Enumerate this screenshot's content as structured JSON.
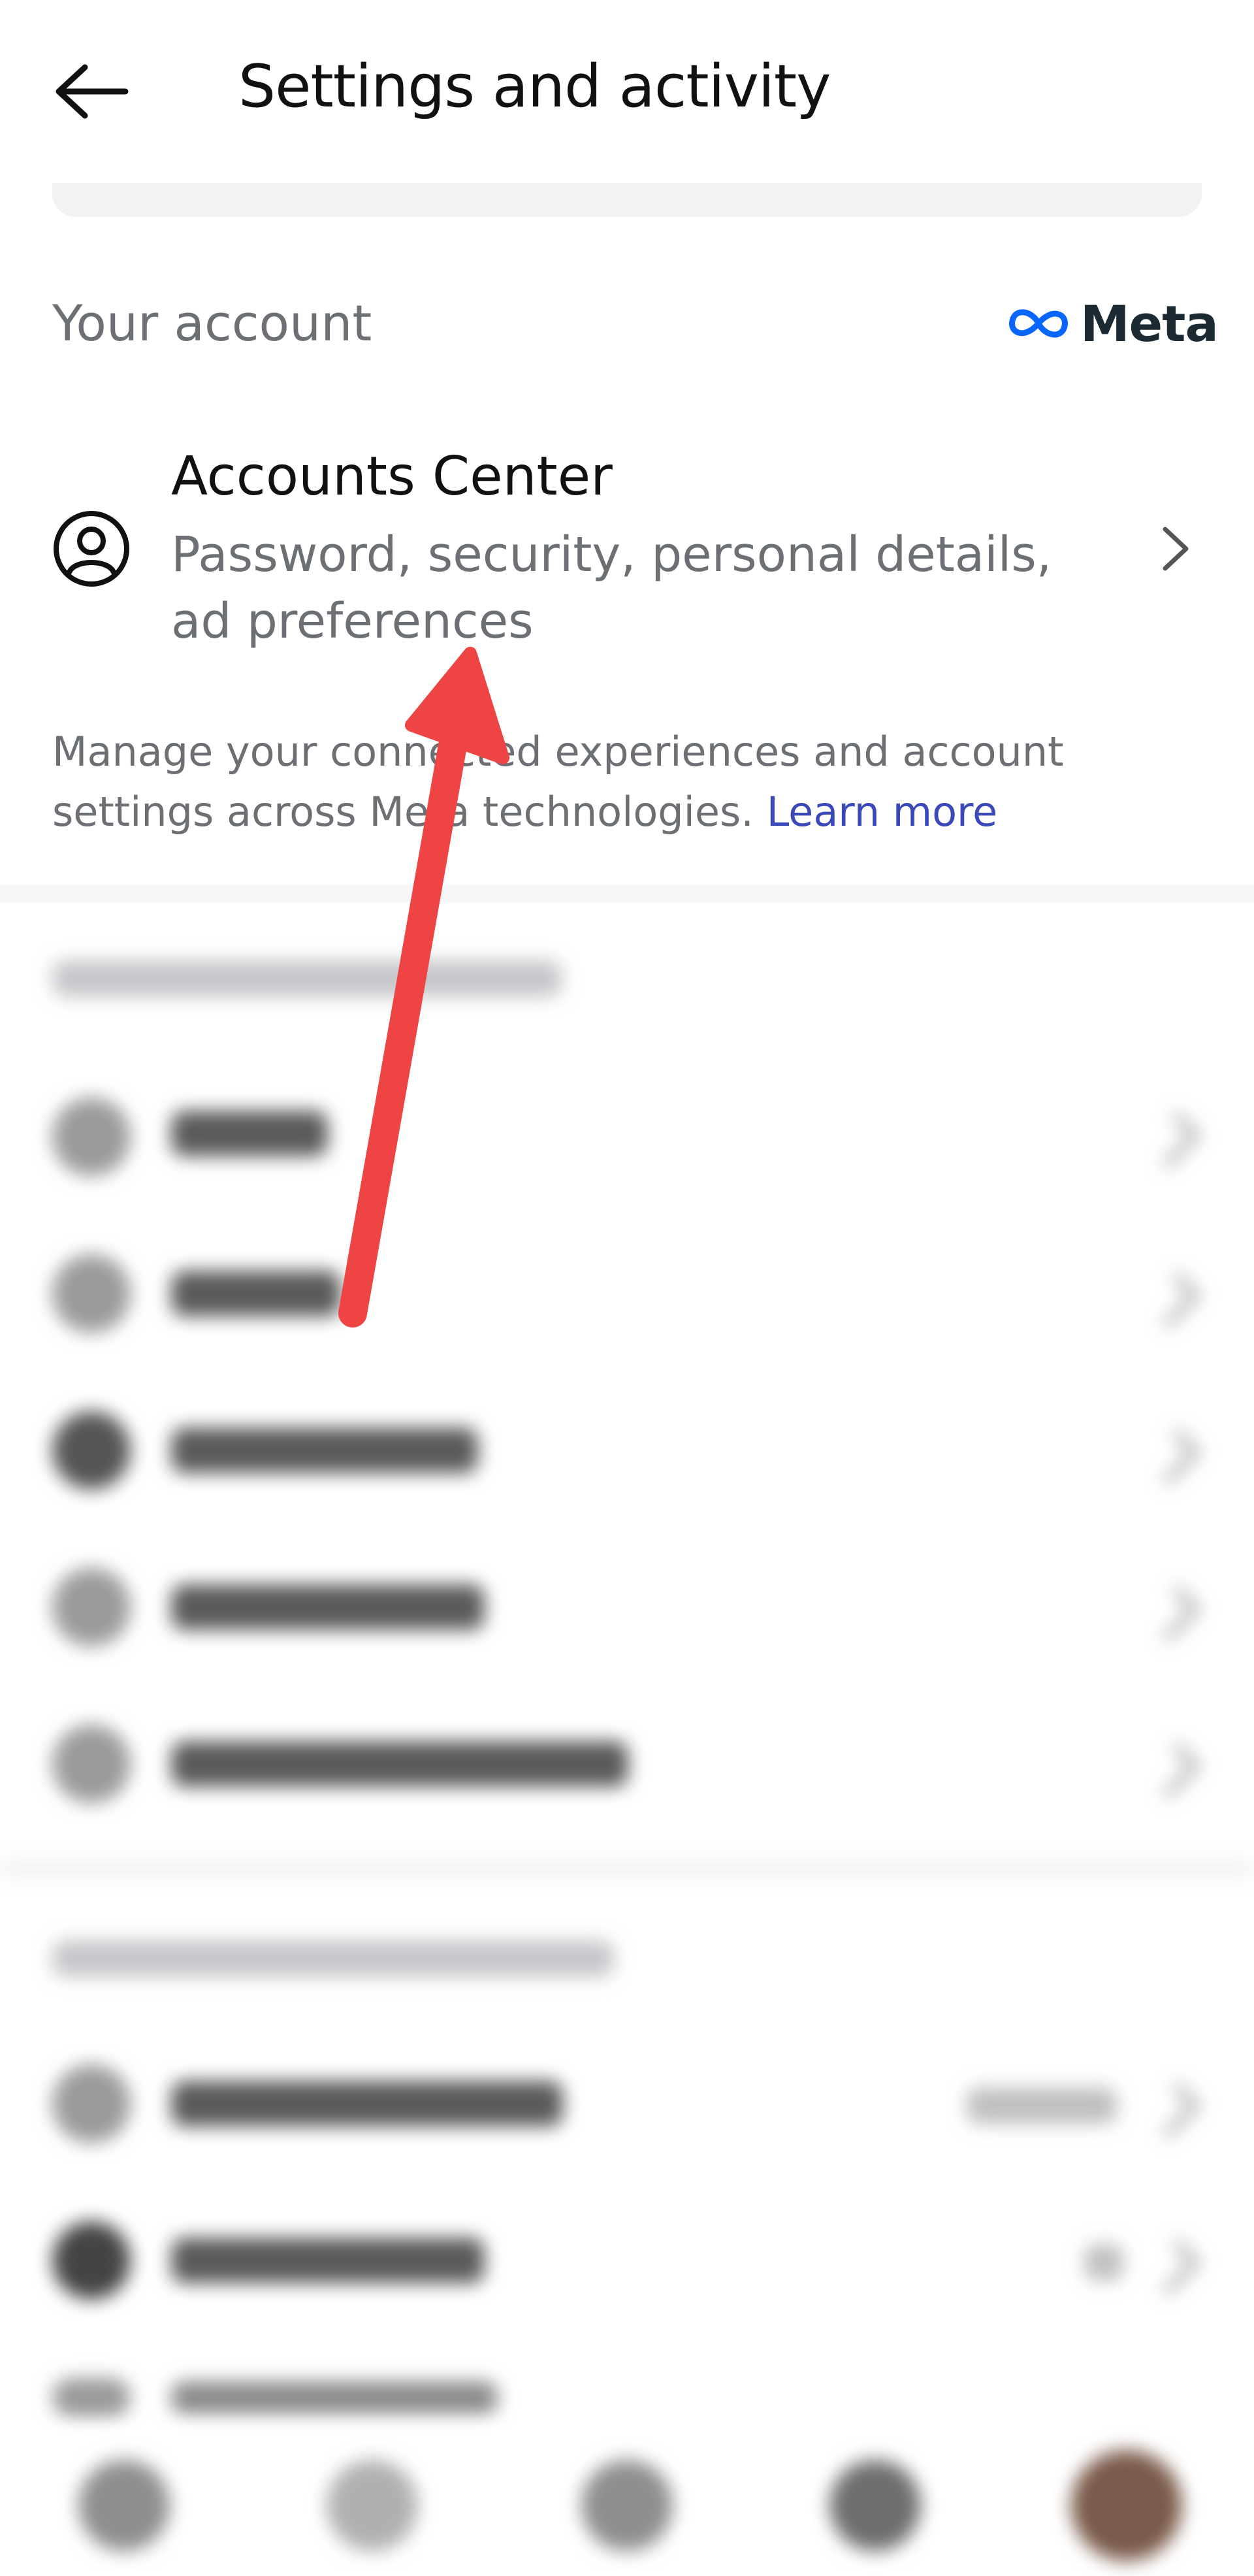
{
  "header": {
    "title": "Settings and activity"
  },
  "your_account": {
    "label": "Your account",
    "brand": "Meta"
  },
  "accounts_center": {
    "title": "Accounts Center",
    "subtitle": "Password, security, personal details, ad preferences"
  },
  "manage": {
    "text": "Manage your connected experiences and account settings across Meta technologies. ",
    "link": "Learn more"
  },
  "colors": {
    "link": "#3a48b8",
    "meta_logo": "#0866ff",
    "annotation_arrow": "#ef4444"
  },
  "icons": {
    "back": "arrow-left-icon",
    "account": "user-circle-icon",
    "chevron": "chevron-right-icon",
    "meta": "meta-infinity-logo"
  }
}
